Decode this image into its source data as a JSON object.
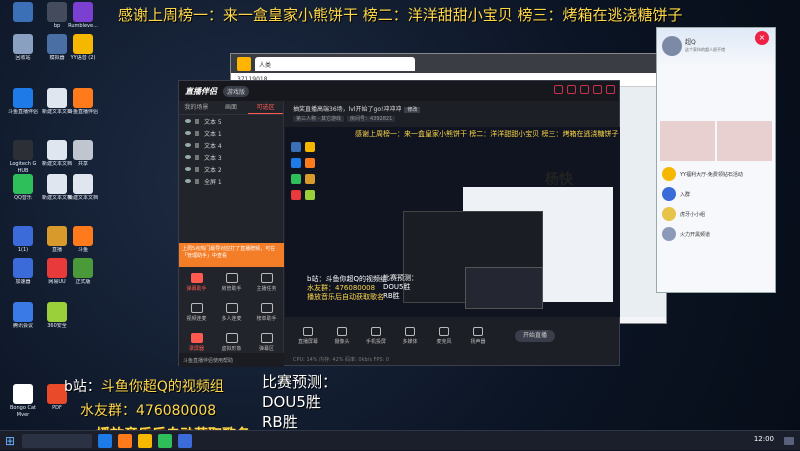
{
  "banner": "感谢上周榜一：来一盒皇家小熊饼干 榜二：洋洋甜甜小宝贝 榜三：烤箱在逃浇糖饼子",
  "desktop_icons": [
    {
      "label": "",
      "color": "#3b6fb6"
    },
    {
      "label": "bp",
      "color": "#444b5c"
    },
    {
      "label": "Rumbleve...",
      "color": "#7b3fd1"
    },
    {
      "label": "回收站",
      "color": "#8aa0c0"
    },
    {
      "label": "模拟器",
      "color": "#4a6fa5"
    },
    {
      "label": "YY语音 (2)",
      "color": "#f5b700"
    },
    {
      "label": "斗鱼直播伴侣",
      "color": "#1e7ae6"
    },
    {
      "label": "新建文本文档",
      "color": "#dfe6f0"
    },
    {
      "label": "斗鱼直播伴侣",
      "color": "#ff7a1a"
    },
    {
      "label": "Logitech G HUB",
      "color": "#2d2f36"
    },
    {
      "label": "新建文本文档",
      "color": "#dfe6f0"
    },
    {
      "label": "共享",
      "color": "#c0c6d0"
    },
    {
      "label": "QQ音乐",
      "color": "#2fbf5a"
    },
    {
      "label": "新建文本文档",
      "color": "#dfe6f0"
    },
    {
      "label": "新建文本文档",
      "color": "#dfe6f0"
    },
    {
      "label": "1(1)",
      "color": "#3a6bd8"
    },
    {
      "label": "直播",
      "color": "#d89a2a"
    },
    {
      "label": "斗鱼",
      "color": "#ff7a1a"
    },
    {
      "label": "加速器",
      "color": "#3a6bd8"
    },
    {
      "label": "网易UU",
      "color": "#e83a3a"
    },
    {
      "label": "正式版",
      "color": "#4a9a3a"
    },
    {
      "label": "腾讯会议",
      "color": "#3a7ae6"
    },
    {
      "label": "360安全",
      "color": "#9ad03a"
    },
    {
      "label": "Bongo Cat Mver",
      "color": "#ffffff"
    },
    {
      "label": "PDF",
      "color": "#e84a2a"
    }
  ],
  "overlay": {
    "bilibili_prefix": "b站：",
    "bilibili_value": "斗鱼你超Q的视频组",
    "qq_group": "水友群：476080008",
    "music_note": "播放音乐后自动获取歌名",
    "predict_lines": [
      "比赛预测：",
      "DOU5胜",
      "RB胜"
    ]
  },
  "assistant": {
    "brand": "直播伴侣",
    "version": "游戏版",
    "tabs": [
      "我的场景",
      "画面",
      "可选区"
    ],
    "active_tab": 2,
    "layers": [
      "文本 5",
      "文本 1",
      "文本 4",
      "文本 3",
      "文本 2",
      "全屏 1"
    ],
    "notice": "上周5点热门最导对应打了直播赠频，可在「管理助手」中查看",
    "tools": [
      {
        "label": "弹幕助手",
        "on": true
      },
      {
        "label": "房管助手",
        "on": false
      },
      {
        "label": "主播任务",
        "on": false
      },
      {
        "label": "视频连麦",
        "on": false
      },
      {
        "label": "多人连麦",
        "on": false
      },
      {
        "label": "榜单助手",
        "on": false
      },
      {
        "label": "录屏器",
        "on": true
      },
      {
        "label": "虚拟形象",
        "on": false
      },
      {
        "label": "弹幕区",
        "on": false
      }
    ],
    "left_footer": "斗鱼直播伴侣使用帮助",
    "room_title": "抽奖直播高端36场，lvl开始了go!冲冲冲",
    "room_edit": "修改",
    "room_tags": [
      "第三人称 - 其它游戏",
      "房间号：4392821"
    ],
    "bottom_tools": [
      "直播屏幕",
      "摄像头",
      "手机投屏",
      "多媒体",
      "麦克风",
      "扬声器"
    ],
    "live_button": "开始直播",
    "status": "CPU: 14%  内存: 42%  码率: 0kb/s  FPS: 0"
  },
  "browser": {
    "tab_title": "人类",
    "address": "37119018",
    "big_text": "杨快"
  },
  "qq": {
    "name": "超Q",
    "status": "这个家伙的超人很不错",
    "contacts": [
      "YY福利大厅-免费领钻石活动",
      "入群",
      "虎牙小小组",
      "火力开黑频道"
    ]
  },
  "preview": {
    "banner": "感谢上周榜一：来一盒皇家小熊饼干 榜二：洋洋甜甜小宝贝 榜三：烤箱在逃浇糖饼子",
    "big": "杨快",
    "bili": "b站：斗鱼你超Q的视频组",
    "qq_group": "水友群：476080008",
    "music": "播放音乐后自动获取歌名",
    "predict": [
      "比赛预测：",
      "DOU5胜",
      "RB胜"
    ]
  },
  "taskbar": {
    "clock": "12:00"
  }
}
